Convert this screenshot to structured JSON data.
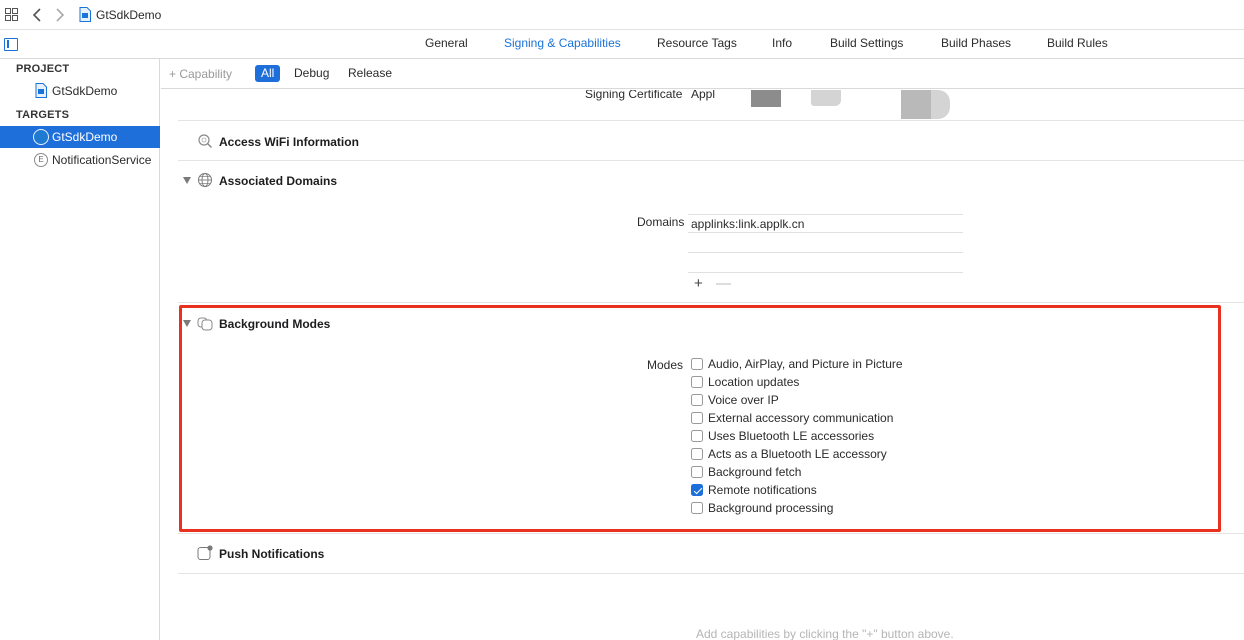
{
  "breadcrumb": {
    "project_name": "GtSdkDemo"
  },
  "tabs": [
    {
      "label": "General"
    },
    {
      "label": "Signing & Capabilities"
    },
    {
      "label": "Resource Tags"
    },
    {
      "label": "Info"
    },
    {
      "label": "Build Settings"
    },
    {
      "label": "Build Phases"
    },
    {
      "label": "Build Rules"
    }
  ],
  "active_tab": "Signing & Capabilities",
  "sidebar": {
    "project_header": "PROJECT",
    "project_item": "GtSdkDemo",
    "targets_header": "TARGETS",
    "targets": [
      {
        "label": "GtSdkDemo",
        "selected": true
      },
      {
        "label": "NotificationService",
        "selected": false
      }
    ]
  },
  "filter": {
    "add_capability": "+ Capability",
    "segments": [
      "All",
      "Debug",
      "Release"
    ],
    "selected": "All"
  },
  "signing": {
    "label": "Signing Certificate",
    "value": "Appl"
  },
  "capabilities": {
    "wifi": {
      "title": "Access WiFi Information"
    },
    "domains": {
      "title": "Associated Domains",
      "field_label": "Domains",
      "entries": [
        "applinks:link.applk.cn",
        ""
      ],
      "add_symbol": "+",
      "remove_symbol": "—"
    },
    "background": {
      "title": "Background Modes",
      "field_label": "Modes",
      "modes": [
        {
          "label": "Audio, AirPlay, and Picture in Picture",
          "checked": false
        },
        {
          "label": "Location updates",
          "checked": false
        },
        {
          "label": "Voice over IP",
          "checked": false
        },
        {
          "label": "External accessory communication",
          "checked": false
        },
        {
          "label": "Uses Bluetooth LE accessories",
          "checked": false
        },
        {
          "label": "Acts as a Bluetooth LE accessory",
          "checked": false
        },
        {
          "label": "Background fetch",
          "checked": false
        },
        {
          "label": "Remote notifications",
          "checked": true
        },
        {
          "label": "Background processing",
          "checked": false
        }
      ]
    },
    "push": {
      "title": "Push Notifications"
    }
  },
  "hint": "Add capabilities by clicking the \"+\" button above.",
  "colors": {
    "accent": "#1e6fd9",
    "highlight": "#e8321f"
  }
}
